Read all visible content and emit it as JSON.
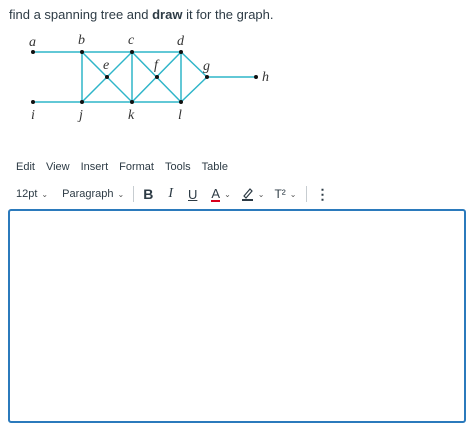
{
  "question": {
    "prefix": "find a spanning tree and ",
    "bold": "draw",
    "suffix": " it for the graph."
  },
  "graph": {
    "labels": [
      "a",
      "b",
      "c",
      "d",
      "e",
      "f",
      "g",
      "h",
      "i",
      "j",
      "k",
      "l"
    ],
    "edge_color": "#2fb5c9"
  },
  "menubar": [
    "Edit",
    "View",
    "Insert",
    "Format",
    "Tools",
    "Table"
  ],
  "toolbar": {
    "font_size": "12pt",
    "block_format": "Paragraph",
    "bold": "B",
    "italic": "I",
    "underline": "U",
    "text_color": "A",
    "superscript": "T²",
    "more": "⋮"
  },
  "editor": {
    "content": ""
  }
}
